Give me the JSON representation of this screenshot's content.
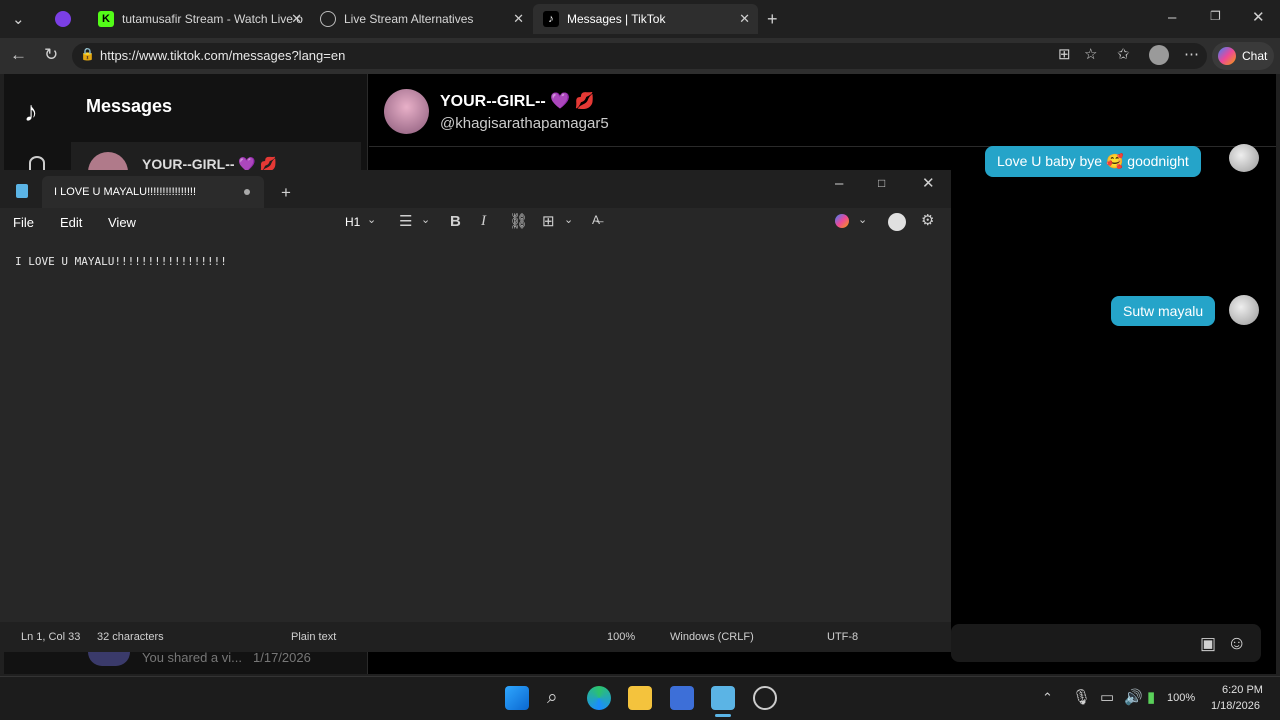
{
  "browser": {
    "tabs": [
      {
        "label": "tutamusafir Stream - Watch Live o",
        "icon": "kick-icon"
      },
      {
        "label": "Live Stream Alternatives",
        "icon": "globe-icon"
      },
      {
        "label": "Messages | TikTok",
        "icon": "tiktok-icon"
      }
    ],
    "url": "https://www.tiktok.com/messages?lang=en",
    "chat_label": "Chat"
  },
  "tiktok": {
    "sidebar_title": "Messages",
    "contact_name": "YOUR--GIRL-- 💜 💋",
    "contact_handle": "@khagisarathapamagar5",
    "list_item_name": "YOUR--GIRL-- 💜 💋",
    "list_item_preview": "You shared a vi...",
    "list_item_date": "1/17/2026",
    "messages": [
      {
        "text": "Love U baby bye 🥰 goodnight"
      },
      {
        "text": "Sutw mayalu"
      }
    ]
  },
  "notepad": {
    "tab_title": "I LOVE U MAYALU!!!!!!!!!!!!!!!!",
    "menu": {
      "file": "File",
      "edit": "Edit",
      "view": "View",
      "heading": "H1"
    },
    "content": "I LOVE U MAYALU!!!!!!!!!!!!!!!!!",
    "status": {
      "position": "Ln 1, Col 33",
      "characters": "32 characters",
      "format": "Plain text",
      "zoom": "100%",
      "line_ending": "Windows (CRLF)",
      "encoding": "UTF-8"
    }
  },
  "taskbar": {
    "battery": "100%",
    "time": "6:20 PM",
    "date": "1/18/2026"
  },
  "colors": {
    "accent": "#25a4c9",
    "notepad_bg": "#272727"
  }
}
